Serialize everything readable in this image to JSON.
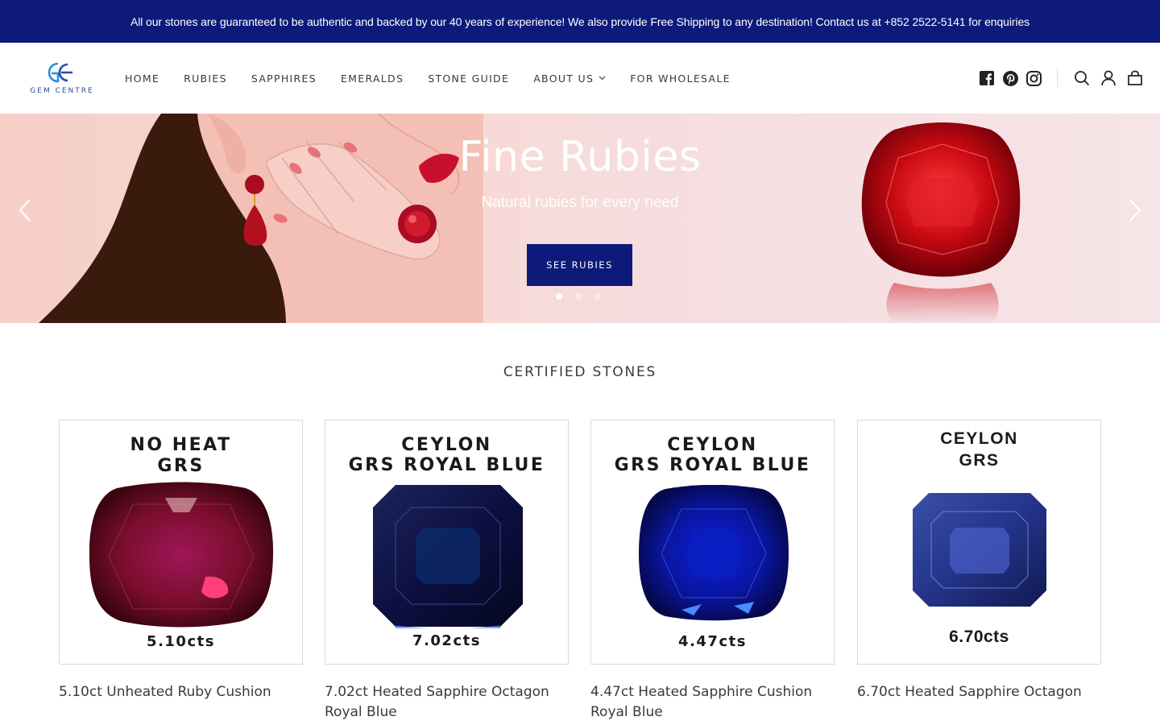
{
  "announcement": {
    "text": "All our stones are guaranteed to be authentic and backed by our 40 years of experience! We also provide Free Shipping to any destination! Contact us at +852 2522-5141 for enquiries"
  },
  "logo": {
    "text": "GEM CENTRE"
  },
  "nav": {
    "items": [
      {
        "label": "HOME"
      },
      {
        "label": "RUBIES"
      },
      {
        "label": "SAPPHIRES"
      },
      {
        "label": "EMERALDS"
      },
      {
        "label": "STONE GUIDE"
      },
      {
        "label": "ABOUT US",
        "has_dropdown": true
      },
      {
        "label": "FOR WHOLESALE"
      }
    ]
  },
  "header_icons": [
    "facebook-icon",
    "pinterest-icon",
    "instagram-icon",
    "search-icon",
    "account-icon",
    "cart-icon"
  ],
  "hero": {
    "title": "Fine Rubies",
    "subtitle": "Natural rubies for every need",
    "button": "SEE RUBIES",
    "slides": 3,
    "active_slide": 1
  },
  "section": {
    "title": "CERTIFIED STONES"
  },
  "products": [
    {
      "label_line1": "NO HEAT",
      "label_line2": "GRS",
      "weight": "5.10cts",
      "title": "5.10ct Unheated Ruby Cushion"
    },
    {
      "label_line1": "CEYLON",
      "label_line2": "GRS ROYAL BLUE",
      "weight": "7.02cts",
      "title": "7.02ct Heated Sapphire Octagon Royal Blue"
    },
    {
      "label_line1": "CEYLON",
      "label_line2": "GRS ROYAL BLUE",
      "weight": "4.47cts",
      "title": "4.47ct Heated Sapphire Cushion Royal Blue"
    },
    {
      "label_line1": "CEYLON",
      "label_line2": "GRS",
      "weight": "6.70cts",
      "title": "6.70ct Heated Sapphire Octagon"
    }
  ],
  "colors": {
    "brand_navy": "#0d1a7a",
    "hero_pink": "#f6cfc7",
    "ruby": "#b0102a",
    "sapphire": "#1a2a9a"
  }
}
